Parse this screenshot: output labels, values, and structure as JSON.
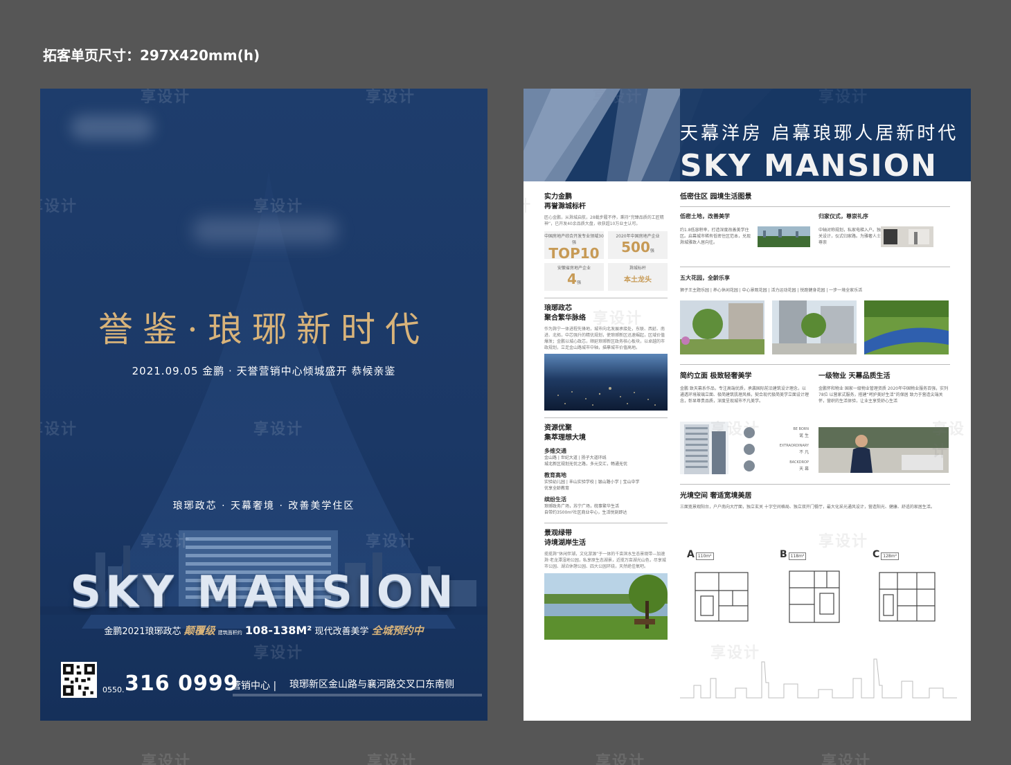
{
  "caption": "拓客单页尺寸：297X420mm(h)",
  "front": {
    "headline": "誉鉴·琅琊新时代",
    "date_line": "2021.09.05 金鹏 · 天誉营销中心倾城盛开 恭候亲鉴",
    "tagline": "琅琊政芯 · 天幕奢境 · 改善美学住区",
    "brand": "SKY MANSION",
    "promo": {
      "pre": "金鹏2021琅琊政芯",
      "gold1": "颠覆级",
      "mid_label": "建筑面积约",
      "area": "108-138M²",
      "post": "现代改善美学",
      "gold2": "全城预约中"
    },
    "area_code": "0550.",
    "phone": "316 0999",
    "sales_label": "营销中心 |",
    "address": "琅琊新区金山路与襄河路交叉口东南侧"
  },
  "back": {
    "slogan": "天幕洋房 启幕琅琊人居新时代",
    "brand": "SKY MANSION",
    "left": {
      "s1": {
        "t1": "实力金鹏",
        "t2": "再誉滁城标杆",
        "text": "匠心金鹏，从滁城启航，28载步履不停，秉持“完臻品质的工匠精神”，已开发40余品质大盘，收获超10万业主认可。"
      },
      "stats": [
        {
          "label": "中国房地产综合开发专业领域30强",
          "value": "TOP10",
          "note": ""
        },
        {
          "label": "2020年中国房地产企业",
          "value": "500",
          "note": "强"
        },
        {
          "label": "安徽省房地产企业",
          "value": "4",
          "note": "强"
        },
        {
          "label": "滁城标杆",
          "value": "本土龙头",
          "note": ""
        }
      ],
      "s2": {
        "t1": "琅琊政芯",
        "t2": "聚合繁华脉络",
        "text": "作为滁宁一体进程先锋地，城市向北发展承接处，东联、西延、南进、北拓，中芯强升的精优规划，使琅琊新区迅速崛起，区域价值爆发；金鹏以城心政芯，顺延琅琊新区政务核心板块，以卓越的市政规划，立足金山路城市中轴，描摹城市价值高地。"
      },
      "s3": {
        "t1": "资源优聚",
        "t2": "集萃理想大境",
        "items": [
          {
            "h": "多维交通",
            "d": "金山路 | 世纪大道 | 扬子大道环线",
            "d2": "城北新区规划无忧之路，多元交汇，畅通无忧"
          },
          {
            "h": "教育高地",
            "d": "实验幼儿园 | 丰山实验学校 | 银山路小学 | 宝山中学",
            "d2": "优享全龄教育"
          },
          {
            "h": "缤纷生活",
            "d": "琅琊政务广场，苏宁广场，皖事繁华生活",
            "d2": "自带约3500m²社区商业中心，生活悦刻即达"
          }
        ]
      },
      "s4": {
        "t1": "景观绿带",
        "t2": "诗境湖岸生活",
        "text": "揽揽滁“休闲伴湖，文化游源”于一体的千亩滨水生态景观带—加速滁·老龙潭湿地公园，私享原生态湖景，近揽万亩湖光山色，尽享城市公园、湖泊休憩公园、四大公园环绕，天然绝佳氧吧。"
      }
    },
    "right": {
      "r1": {
        "title": "低密住区 园境生活图景",
        "a": {
          "h": "低密土地，改善美学",
          "text": "约1.8低容积率，打造深度改善美学住区。启幕城市稀有低密住区范本，兑现滁城雅致人居向往。",
          "hl": "1.8"
        },
        "b": {
          "h": "归家仪式，尊崇礼序",
          "text": "中轴对称规划，私家电梯入户。独立玄关设计，仪式归家路。为雅奢人士定制尊崇"
        }
      },
      "r2": {
        "h": "五大花园，全龄乐享",
        "list": "狮子王主题乐园 | 养心休闲花园 | 中心景观花园 | 活力运动花园 | 悦跑健身花园 | 一步一境全家乐活"
      },
      "r3": {
        "title": "简约立面 极致轻奢美学",
        "text": "金鹏 致天幕系作品，专注高端优质，承袭国际前沿建筑设计理念，以通透环境玻璃立面、极简建筑肌理风格，契合现代极简美学立面设计理念，彰显尊贵品质，深度呈现城市不凡美学。",
        "labels": [
          {
            "en": "BE BORN",
            "cn": "诞 生"
          },
          {
            "en": "EXTRAORDINARY",
            "cn": "不 凡"
          },
          {
            "en": "BACKDROP",
            "cn": "天 幕"
          }
        ]
      },
      "r4": {
        "title": "一级物业 天幕品质生活",
        "text": "金鹏怀和物业 国家一级物业管理资质 2020年中国物业服务百强，实列78位 以营家式服务，搭建“呵护美好生活”的保居 致力于营造尖端关怀，营织的生活体验，让业主享受舒心生活",
        "hl": "78"
      },
      "r5": {
        "title": "光境空间 奢适宽境美居",
        "text": "三面宽景观阳台，户户南向大厅面，独立玄关 十字空间格局、独立双开门餐厅，最大化采光通风设计，营造阳光、健康、舒适的家居生活。"
      },
      "plans": [
        {
          "label": "A",
          "area": "110m²"
        },
        {
          "label": "B",
          "area": "118m²"
        },
        {
          "label": "C",
          "area": "128m²"
        }
      ]
    }
  },
  "watermark": "享设计",
  "colors": {
    "navy": "#1d3b6a",
    "gold": "#d8b37a",
    "accent": "#c79a55"
  }
}
